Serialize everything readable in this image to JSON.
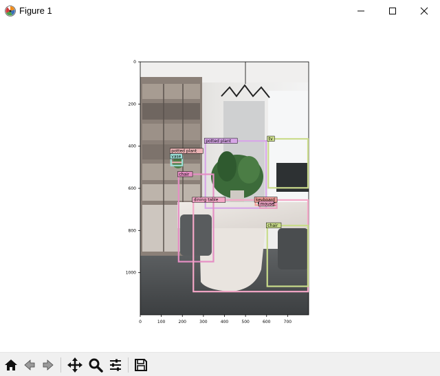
{
  "window": {
    "title": "Figure 1",
    "icons": [
      "matplotlib-logo-icon",
      "minimize-icon",
      "maximize-icon",
      "close-icon"
    ]
  },
  "toolbar": {
    "tools": [
      {
        "name": "home",
        "icon": "home-icon"
      },
      {
        "name": "back",
        "icon": "back-arrow-icon"
      },
      {
        "name": "forward",
        "icon": "forward-arrow-icon"
      },
      {
        "name": "pan",
        "icon": "move-icon"
      },
      {
        "name": "zoom",
        "icon": "zoom-icon"
      },
      {
        "name": "configure",
        "icon": "sliders-icon"
      },
      {
        "name": "save",
        "icon": "save-icon"
      }
    ]
  },
  "chart_data": {
    "type": "image-detection",
    "image_extent": {
      "x": [
        0,
        800
      ],
      "y": [
        0,
        1200
      ]
    },
    "x_ticks": [
      0,
      100,
      200,
      300,
      400,
      500,
      600,
      700
    ],
    "y_ticks": [
      0,
      200,
      400,
      600,
      800,
      1000
    ],
    "y_inverted": true,
    "detections": [
      {
        "label": "potted plant",
        "x0": 306,
        "y0": 372,
        "x1": 601,
        "y1": 697,
        "color": "#d7a6e8"
      },
      {
        "label": "tv",
        "x0": 605,
        "y0": 362,
        "x1": 800,
        "y1": 601,
        "color": "#cbdc8c"
      },
      {
        "label": "potted plant",
        "x0": 143,
        "y0": 420,
        "x1": 203,
        "y1": 480,
        "color": "#ebb3b5"
      },
      {
        "label": "vase",
        "x0": 143,
        "y0": 445,
        "x1": 203,
        "y1": 495,
        "color": "#9ee0d8"
      },
      {
        "label": "chair",
        "x0": 179,
        "y0": 530,
        "x1": 351,
        "y1": 951,
        "color": "#e58fc4"
      },
      {
        "label": "dining table",
        "x0": 249,
        "y0": 652,
        "x1": 800,
        "y1": 1093,
        "color": "#f4a7c7"
      },
      {
        "label": "keyboard",
        "x0": 544,
        "y0": 651,
        "x1": 649,
        "y1": 683,
        "color": "#f29f9a"
      },
      {
        "label": "mouse",
        "x0": 565,
        "y0": 670,
        "x1": 652,
        "y1": 697,
        "color": "#e89fbf"
      },
      {
        "label": "chair",
        "x0": 600,
        "y0": 773,
        "x1": 800,
        "y1": 1068,
        "color": "#c9dc8a"
      }
    ]
  }
}
